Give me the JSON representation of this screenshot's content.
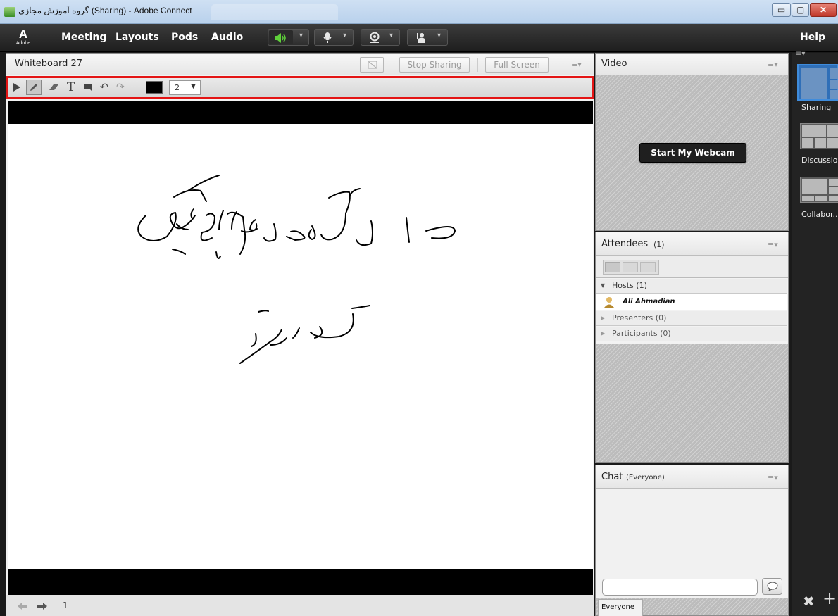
{
  "window": {
    "title": "گروه آموزش مجازی (Sharing) - Adobe Connect",
    "minimize_glyph": "▭",
    "maximize_glyph": "▢",
    "close_glyph": "✕"
  },
  "menubar": {
    "logo_mark": "A",
    "logo_text": "Adobe",
    "items": [
      "Meeting",
      "Layouts",
      "Pods",
      "Audio"
    ],
    "help": "Help",
    "speaker_icon": "speaker-icon",
    "mic_icon": "microphone-icon",
    "webcam_icon": "webcam-icon",
    "status_icon": "raise-hand-icon",
    "speaker_active_color": "#5fd13a"
  },
  "whiteboard": {
    "title": "Whiteboard 27",
    "stop_sharing": "Stop Sharing",
    "full_screen": "Full Screen",
    "stroke_size": "2",
    "stroke_color": "#000000",
    "page_number": "1",
    "tools": [
      "select-icon",
      "pencil-icon",
      "eraser-icon",
      "text-icon",
      "shape-icon",
      "undo-icon",
      "redo-icon"
    ]
  },
  "video": {
    "title": "Video",
    "start_webcam": "Start My Webcam"
  },
  "attendees": {
    "title": "Attendees",
    "count": "(1)",
    "hosts_label": "Hosts (1)",
    "host_name": "Ali Ahmadian",
    "presenters_label": "Presenters (0)",
    "participants_label": "Participants (0)"
  },
  "chat": {
    "title": "Chat",
    "scope": "(Everyone)",
    "tab_label": "Everyone",
    "message_value": ""
  },
  "layouts": {
    "items": [
      "Sharing",
      "Discussion",
      "Collabor..."
    ]
  },
  "highlight_color": "#e41515"
}
